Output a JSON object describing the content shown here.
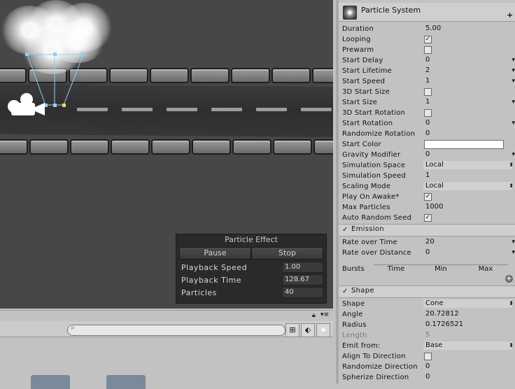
{
  "particle_effect": {
    "title": "Particle Effect",
    "pause_label": "Pause",
    "stop_label": "Stop",
    "rows": [
      {
        "label": "Playback Speed",
        "value": "1.00"
      },
      {
        "label": "Playback Time",
        "value": "128.67"
      },
      {
        "label": "Particles",
        "value": "40"
      }
    ]
  },
  "inspector": {
    "component_title": "Particle System",
    "main": [
      {
        "label": "Duration",
        "value": "5.00",
        "kind": "text"
      },
      {
        "label": "Looping",
        "value": "✓",
        "kind": "check"
      },
      {
        "label": "Prewarm",
        "value": "",
        "kind": "check"
      },
      {
        "label": "Start Delay",
        "value": "0",
        "kind": "drop"
      },
      {
        "label": "Start Lifetime",
        "value": "2",
        "kind": "drop"
      },
      {
        "label": "Start Speed",
        "value": "1",
        "kind": "drop"
      },
      {
        "label": "3D Start Size",
        "value": "",
        "kind": "check"
      },
      {
        "label": "Start Size",
        "value": "1",
        "kind": "drop"
      },
      {
        "label": "3D Start Rotation",
        "value": "",
        "kind": "check"
      },
      {
        "label": "Start Rotation",
        "value": "0",
        "kind": "drop"
      },
      {
        "label": "Randomize Rotation",
        "value": "0",
        "kind": "text"
      },
      {
        "label": "Start Color",
        "value": "",
        "kind": "color"
      },
      {
        "label": "Gravity Modifier",
        "value": "0",
        "kind": "drop"
      },
      {
        "label": "Simulation Space",
        "value": "Local",
        "kind": "enum"
      },
      {
        "label": "Simulation Speed",
        "value": "1",
        "kind": "text"
      },
      {
        "label": "Scaling Mode",
        "value": "Local",
        "kind": "enum"
      },
      {
        "label": "Play On Awake*",
        "value": "✓",
        "kind": "check"
      },
      {
        "label": "Max Particles",
        "value": "1000",
        "kind": "text"
      },
      {
        "label": "Auto Random Seed",
        "value": "✓",
        "kind": "check"
      }
    ],
    "emission": {
      "check": "✓",
      "title": "Emission",
      "rows": [
        {
          "label": "Rate over Time",
          "value": "20",
          "kind": "drop"
        },
        {
          "label": "Rate over Distance",
          "value": "0",
          "kind": "drop"
        }
      ],
      "bursts_label": "Bursts",
      "bursts_columns": [
        "Time",
        "Min",
        "Max"
      ]
    },
    "shape": {
      "check": "✓",
      "title": "Shape",
      "rows": [
        {
          "label": "Shape",
          "value": "Cone",
          "kind": "enum"
        },
        {
          "label": "Angle",
          "value": "20.72812",
          "kind": "text"
        },
        {
          "label": "Radius",
          "value": "0.1726521",
          "kind": "text"
        },
        {
          "label": "Length",
          "value": "5",
          "kind": "text",
          "disabled": true
        },
        {
          "label": "Emit from:",
          "value": "Base",
          "kind": "enum"
        },
        {
          "label": "Align To Direction",
          "value": "",
          "kind": "check"
        },
        {
          "label": "Randomize Direction",
          "value": "0",
          "kind": "text"
        },
        {
          "label": "Spherize Direction",
          "value": "0",
          "kind": "text"
        }
      ]
    }
  },
  "icons": {
    "component": "particle-system-icon",
    "add": "plus-icon",
    "lock": "lock-icon",
    "menu": "menu-icon",
    "search": "search-icon",
    "filter_type": "filter-type-icon",
    "filter_label": "label-icon",
    "favorite": "star-icon"
  },
  "colors": {
    "scene_bg": "#474747",
    "inspector_bg": "#c2c2c2",
    "start_color": "#ffffff"
  }
}
